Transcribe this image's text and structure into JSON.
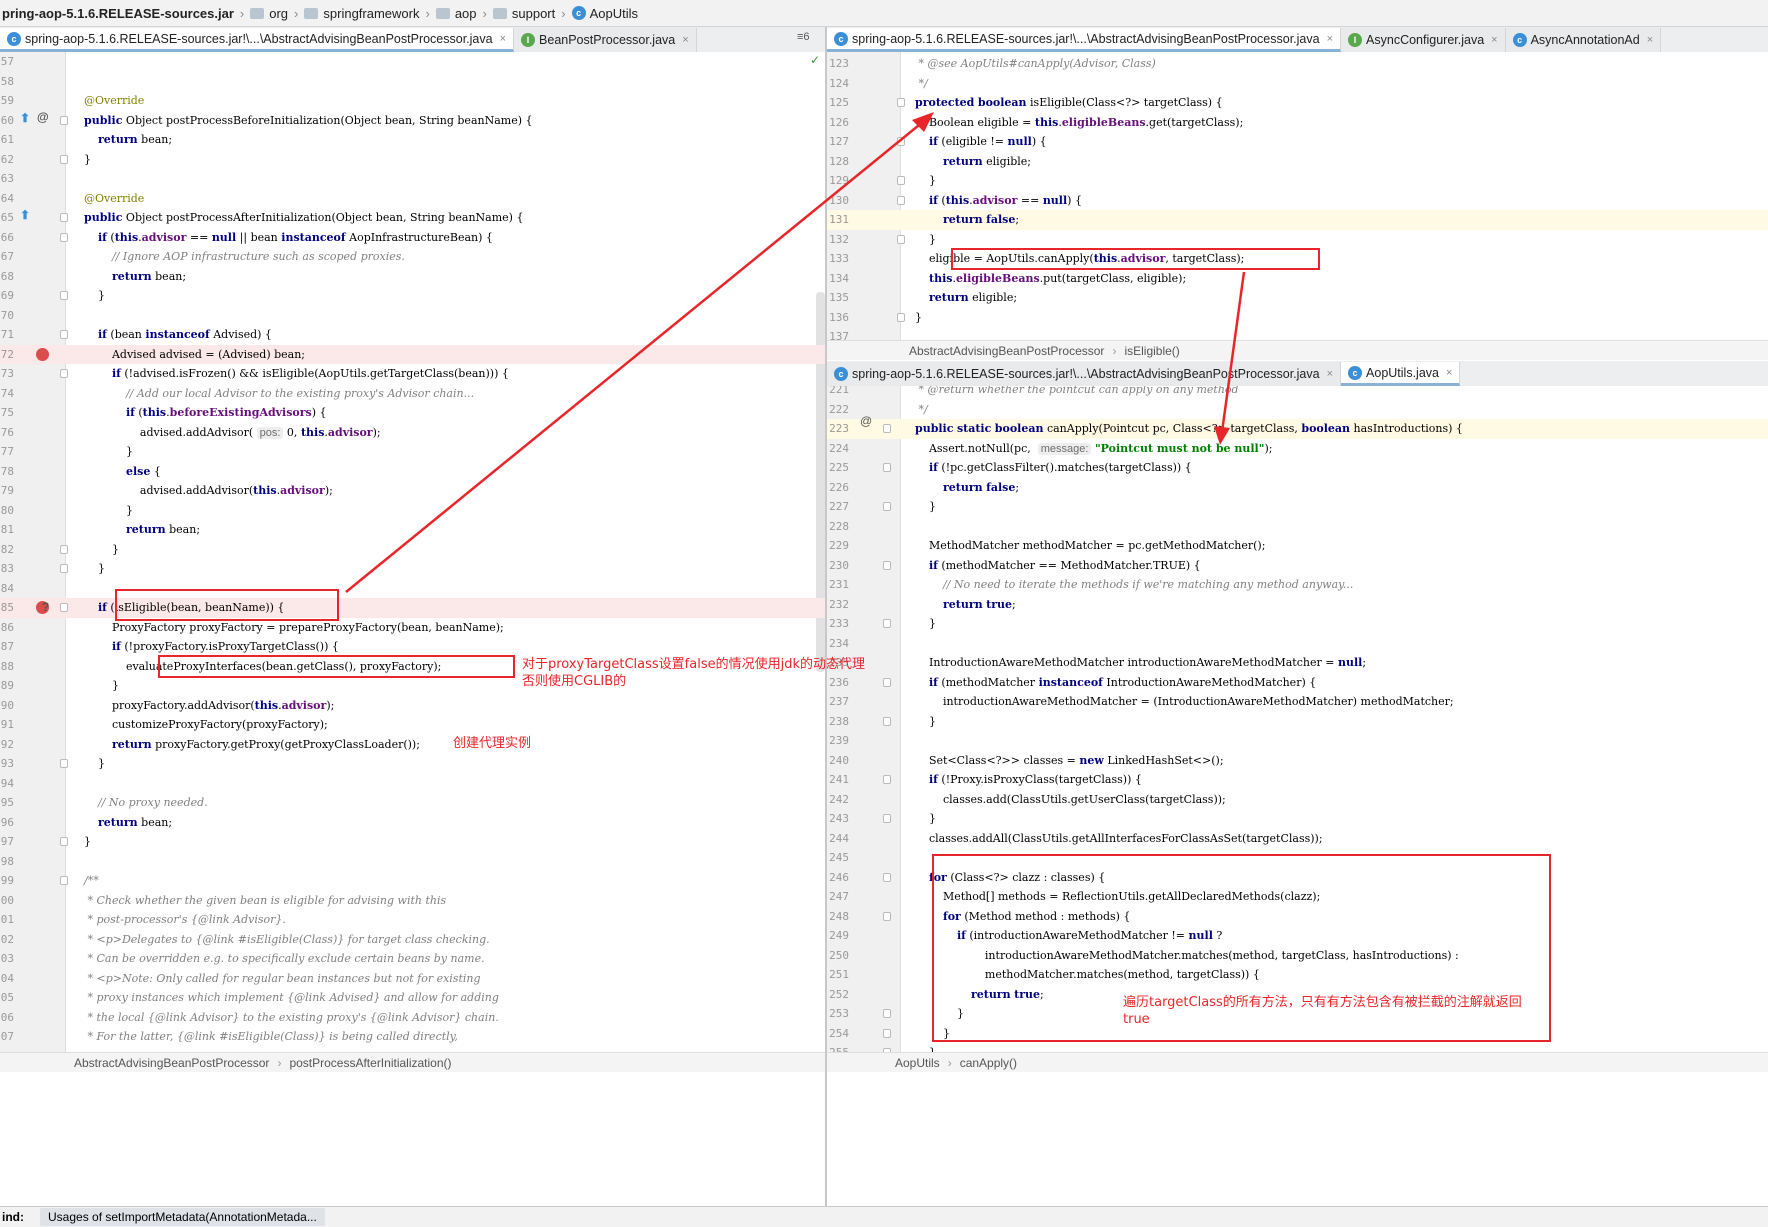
{
  "nav": {
    "crumbs": [
      "pring-aop-5.1.6.RELEASE-sources.jar",
      "org",
      "springframework",
      "aop",
      "support",
      "AopUtils"
    ]
  },
  "left": {
    "tabs": [
      {
        "label": "spring-aop-5.1.6.RELEASE-sources.jar!\\...\\AbstractAdvisingBeanPostProcessor.java",
        "active": true,
        "icon": "class-icon"
      },
      {
        "label": "BeanPostProcessor.java",
        "active": false,
        "icon": "interface-icon"
      }
    ],
    "tab_overflow": "≡6",
    "lines": [
      {
        "n": "57",
        "t": ""
      },
      {
        "n": "58",
        "t": ""
      },
      {
        "n": "59",
        "t": "    @Override"
      },
      {
        "n": "60",
        "t": "    public Object postProcessBeforeInitialization(Object bean, String beanName) {"
      },
      {
        "n": "61",
        "t": "        return bean;"
      },
      {
        "n": "62",
        "t": "    }"
      },
      {
        "n": "63",
        "t": ""
      },
      {
        "n": "64",
        "t": "    @Override"
      },
      {
        "n": "65",
        "t": "    public Object postProcessAfterInitialization(Object bean, String beanName) {"
      },
      {
        "n": "66",
        "t": "        if (this.advisor == null || bean instanceof AopInfrastructureBean) {"
      },
      {
        "n": "67",
        "t": "            // Ignore AOP infrastructure such as scoped proxies."
      },
      {
        "n": "68",
        "t": "            return bean;"
      },
      {
        "n": "69",
        "t": "        }"
      },
      {
        "n": "70",
        "t": ""
      },
      {
        "n": "71",
        "t": "        if (bean instanceof Advised) {"
      },
      {
        "n": "72",
        "t": "            Advised advised = (Advised) bean;"
      },
      {
        "n": "73",
        "t": "            if (!advised.isFrozen() && isEligible(AopUtils.getTargetClass(bean))) {"
      },
      {
        "n": "74",
        "t": "                // Add our local Advisor to the existing proxy's Advisor chain..."
      },
      {
        "n": "75",
        "t": "                if (this.beforeExistingAdvisors) {"
      },
      {
        "n": "76",
        "t": "                    advised.addAdvisor( pos: 0, this.advisor);"
      },
      {
        "n": "77",
        "t": "                }"
      },
      {
        "n": "78",
        "t": "                else {"
      },
      {
        "n": "79",
        "t": "                    advised.addAdvisor(this.advisor);"
      },
      {
        "n": "80",
        "t": "                }"
      },
      {
        "n": "81",
        "t": "                return bean;"
      },
      {
        "n": "82",
        "t": "            }"
      },
      {
        "n": "83",
        "t": "        }"
      },
      {
        "n": "84",
        "t": ""
      },
      {
        "n": "85",
        "t": "        if (isEligible(bean, beanName)) {"
      },
      {
        "n": "86",
        "t": "            ProxyFactory proxyFactory = prepareProxyFactory(bean, beanName);"
      },
      {
        "n": "87",
        "t": "            if (!proxyFactory.isProxyTargetClass()) {"
      },
      {
        "n": "88",
        "t": "                evaluateProxyInterfaces(bean.getClass(), proxyFactory);"
      },
      {
        "n": "89",
        "t": "            }"
      },
      {
        "n": "90",
        "t": "            proxyFactory.addAdvisor(this.advisor);"
      },
      {
        "n": "91",
        "t": "            customizeProxyFactory(proxyFactory);"
      },
      {
        "n": "92",
        "t": "            return proxyFactory.getProxy(getProxyClassLoader());"
      },
      {
        "n": "93",
        "t": "        }"
      },
      {
        "n": "94",
        "t": ""
      },
      {
        "n": "95",
        "t": "        // No proxy needed."
      },
      {
        "n": "96",
        "t": "        return bean;"
      },
      {
        "n": "97",
        "t": "    }"
      },
      {
        "n": "98",
        "t": ""
      },
      {
        "n": "99",
        "t": "    /**"
      },
      {
        "n": "00",
        "t": "     * Check whether the given bean is eligible for advising with this"
      },
      {
        "n": "01",
        "t": "     * post-processor's {@link Advisor}."
      },
      {
        "n": "02",
        "t": "     * <p>Delegates to {@link #isEligible(Class)} for target class checking."
      },
      {
        "n": "03",
        "t": "     * Can be overridden e.g. to specifically exclude certain beans by name."
      },
      {
        "n": "04",
        "t": "     * <p>Note: Only called for regular bean instances but not for existing"
      },
      {
        "n": "05",
        "t": "     * proxy instances which implement {@link Advised} and allow for adding"
      },
      {
        "n": "06",
        "t": "     * the local {@link Advisor} to the existing proxy's {@link Advisor} chain."
      },
      {
        "n": "07",
        "t": "     * For the latter, {@link #isEligible(Class)} is being called directly,"
      }
    ],
    "status": [
      "AbstractAdvisingBeanPostProcessor",
      "postProcessAfterInitialization()"
    ]
  },
  "right_top": {
    "tabs": [
      {
        "label": "spring-aop-5.1.6.RELEASE-sources.jar!\\...\\AbstractAdvisingBeanPostProcessor.java",
        "active": true,
        "icon": "class-icon"
      },
      {
        "label": "AsyncConfigurer.java",
        "active": false,
        "icon": "interface-icon"
      },
      {
        "label": "AsyncAnnotationAd",
        "active": false,
        "icon": "class-icon"
      }
    ],
    "lines": [
      {
        "n": "123",
        "t": "     * @see AopUtils#canApply(Advisor, Class)"
      },
      {
        "n": "124",
        "t": "     */"
      },
      {
        "n": "125",
        "t": "    protected boolean isEligible(Class<?> targetClass) {"
      },
      {
        "n": "126",
        "t": "        Boolean eligible = this.eligibleBeans.get(targetClass);"
      },
      {
        "n": "127",
        "t": "        if (eligible != null) {"
      },
      {
        "n": "128",
        "t": "            return eligible;"
      },
      {
        "n": "129",
        "t": "        }"
      },
      {
        "n": "130",
        "t": "        if (this.advisor == null) {"
      },
      {
        "n": "131",
        "t": "            return false;"
      },
      {
        "n": "132",
        "t": "        }"
      },
      {
        "n": "133",
        "t": "        eligible = AopUtils.canApply(this.advisor, targetClass);"
      },
      {
        "n": "134",
        "t": "        this.eligibleBeans.put(targetClass, eligible);"
      },
      {
        "n": "135",
        "t": "        return eligible;"
      },
      {
        "n": "136",
        "t": "    }"
      },
      {
        "n": "137",
        "t": ""
      }
    ],
    "status": [
      "AbstractAdvisingBeanPostProcessor",
      "isEligible()"
    ]
  },
  "right_bottom": {
    "tabs": [
      {
        "label": "spring-aop-5.1.6.RELEASE-sources.jar!\\...\\AbstractAdvisingBeanPostProcessor.java",
        "active": false,
        "icon": "class-icon"
      },
      {
        "label": "AopUtils.java",
        "active": true,
        "icon": "class-icon"
      }
    ],
    "lines": [
      {
        "n": "221",
        "t": "     * @return whether the pointcut can apply on any method"
      },
      {
        "n": "222",
        "t": "     */"
      },
      {
        "n": "223",
        "t": "    public static boolean canApply(Pointcut pc, Class<?> targetClass, boolean hasIntroductions) {"
      },
      {
        "n": "224",
        "t": "        Assert.notNull(pc,  message: \"Pointcut must not be null\");"
      },
      {
        "n": "225",
        "t": "        if (!pc.getClassFilter().matches(targetClass)) {"
      },
      {
        "n": "226",
        "t": "            return false;"
      },
      {
        "n": "227",
        "t": "        }"
      },
      {
        "n": "228",
        "t": ""
      },
      {
        "n": "229",
        "t": "        MethodMatcher methodMatcher = pc.getMethodMatcher();"
      },
      {
        "n": "230",
        "t": "        if (methodMatcher == MethodMatcher.TRUE) {"
      },
      {
        "n": "231",
        "t": "            // No need to iterate the methods if we're matching any method anyway..."
      },
      {
        "n": "232",
        "t": "            return true;"
      },
      {
        "n": "233",
        "t": "        }"
      },
      {
        "n": "234",
        "t": ""
      },
      {
        "n": "235",
        "t": "        IntroductionAwareMethodMatcher introductionAwareMethodMatcher = null;"
      },
      {
        "n": "236",
        "t": "        if (methodMatcher instanceof IntroductionAwareMethodMatcher) {"
      },
      {
        "n": "237",
        "t": "            introductionAwareMethodMatcher = (IntroductionAwareMethodMatcher) methodMatcher;"
      },
      {
        "n": "238",
        "t": "        }"
      },
      {
        "n": "239",
        "t": ""
      },
      {
        "n": "240",
        "t": "        Set<Class<?>> classes = new LinkedHashSet<>();"
      },
      {
        "n": "241",
        "t": "        if (!Proxy.isProxyClass(targetClass)) {"
      },
      {
        "n": "242",
        "t": "            classes.add(ClassUtils.getUserClass(targetClass));"
      },
      {
        "n": "243",
        "t": "        }"
      },
      {
        "n": "244",
        "t": "        classes.addAll(ClassUtils.getAllInterfacesForClassAsSet(targetClass));"
      },
      {
        "n": "245",
        "t": ""
      },
      {
        "n": "246",
        "t": "        for (Class<?> clazz : classes) {"
      },
      {
        "n": "247",
        "t": "            Method[] methods = ReflectionUtils.getAllDeclaredMethods(clazz);"
      },
      {
        "n": "248",
        "t": "            for (Method method : methods) {"
      },
      {
        "n": "249",
        "t": "                if (introductionAwareMethodMatcher != null ?"
      },
      {
        "n": "250",
        "t": "                        introductionAwareMethodMatcher.matches(method, targetClass, hasIntroductions) :"
      },
      {
        "n": "251",
        "t": "                        methodMatcher.matches(method, targetClass)) {"
      },
      {
        "n": "252",
        "t": "                    return true;"
      },
      {
        "n": "253",
        "t": "                }"
      },
      {
        "n": "254",
        "t": "            }"
      },
      {
        "n": "255",
        "t": "        }"
      }
    ],
    "status": [
      "AopUtils",
      "canApply()"
    ]
  },
  "annotations": {
    "jdk_proxy": "对于proxyTargetClass设置false的情况使用jdk的动态代理\n否则使用CGLIB的",
    "create_proxy": "创建代理实例",
    "iterate": "遍历targetClass的所有方法，只有有方法包含有被拦截的注解就返回\ntrue"
  },
  "findbar": {
    "label": "ind:",
    "tab": "Usages of setImportMetadata(AnnotationMetada..."
  },
  "colors": {
    "annotation_red": "#e8262a",
    "keyword": "#000080",
    "breakpoint": "#db4c4c"
  }
}
